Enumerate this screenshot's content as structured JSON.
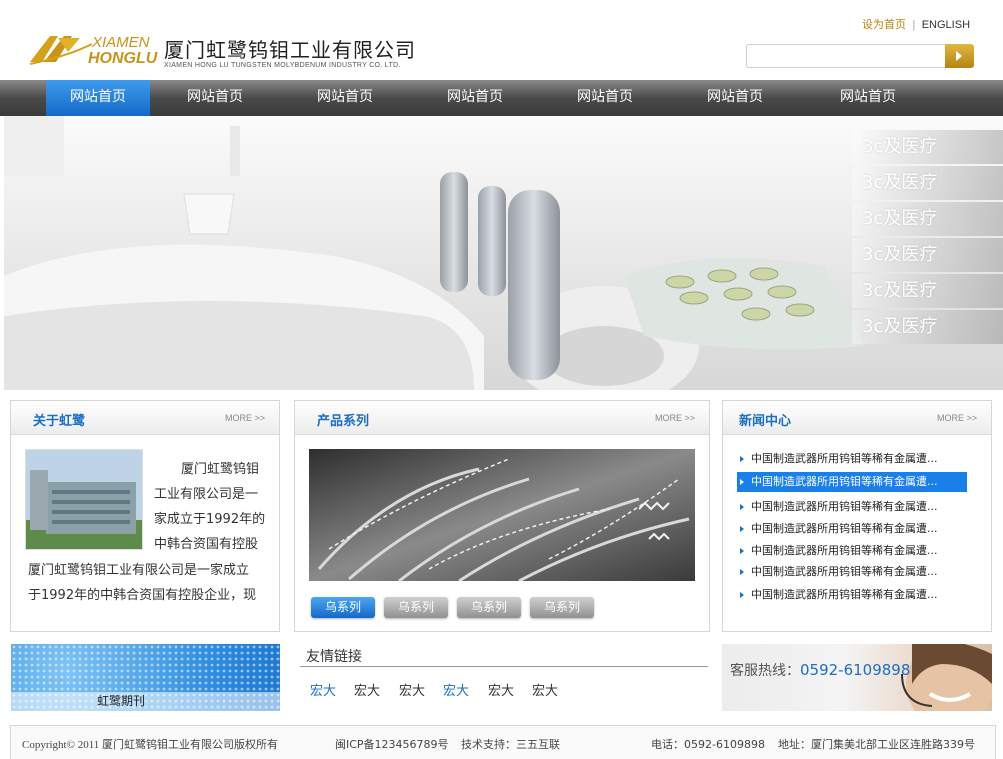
{
  "header": {
    "logo_en_line1": "XIAMEN",
    "logo_en_line2": "HONGLU",
    "company_name": "厦门虹鹭钨钼工业有限公司",
    "company_name_en": "XIAMEN HONG LU TUNGSTEN MOLYBDENUM INDUSTRY CO. LTD.",
    "set_home": "设为首页",
    "separator": "|",
    "english": "ENGLISH",
    "search_value": ""
  },
  "nav": {
    "items": [
      "网站首页",
      "网站首页",
      "网站首页",
      "网站首页",
      "网站首页",
      "网站首页",
      "网站首页"
    ],
    "active_index": 0
  },
  "banner": {
    "items": [
      "3c及医疗",
      "3c及医疗",
      "3c及医疗",
      "3c及医疗",
      "3c及医疗",
      "3c及医疗"
    ]
  },
  "about": {
    "title": "关于虹鹭",
    "more": "MORE >>",
    "lines_right": [
      "厦门虹鹭钨钼",
      "工业有限公司是一",
      "家成立于1992年的",
      "中韩合资国有控股"
    ],
    "lines_full": [
      "厦门虹鹭钨钼工业有限公司是一家成立",
      "于1992年的中韩合资国有控股企业，现"
    ]
  },
  "products": {
    "title": "产品系列",
    "more": "MORE >>",
    "tabs": [
      "乌系列",
      "乌系列",
      "乌系列",
      "乌系列"
    ],
    "active_tab": 0
  },
  "news": {
    "title": "新闻中心",
    "more": "MORE >>",
    "items": [
      "中国制造武器所用钨钼等稀有金属遭...",
      "中国制造武器所用钨钼等稀有金属遭...",
      "中国制造武器所用钨钼等稀有金属遭...",
      "中国制造武器所用钨钼等稀有金属遭...",
      "中国制造武器所用钨钼等稀有金属遭...",
      "中国制造武器所用钨钼等稀有金属遭...",
      "中国制造武器所用钨钼等稀有金属遭..."
    ],
    "active_index": 1
  },
  "magazine": {
    "label": "虹鹭期刊"
  },
  "links": {
    "title": "友情链接",
    "items": [
      "宏大",
      "宏大",
      "宏大",
      "宏大",
      "宏大",
      "宏大"
    ]
  },
  "hotline": {
    "label": "客服热线：",
    "number": "0592-6109898"
  },
  "footer": {
    "copyright": "Copyright© 2011 厦门虹鹭钨钼工业有限公司版权所有",
    "icp": "闽ICP备123456789号",
    "support": "技术支持：三五互联",
    "phone": "电话：0592-6109898",
    "address": "地址：厦门集美北部工业区连胜路339号"
  },
  "colors": {
    "accent_blue": "#1a6fc4",
    "nav_active": "#1469c7",
    "gold": "#b8860b"
  }
}
